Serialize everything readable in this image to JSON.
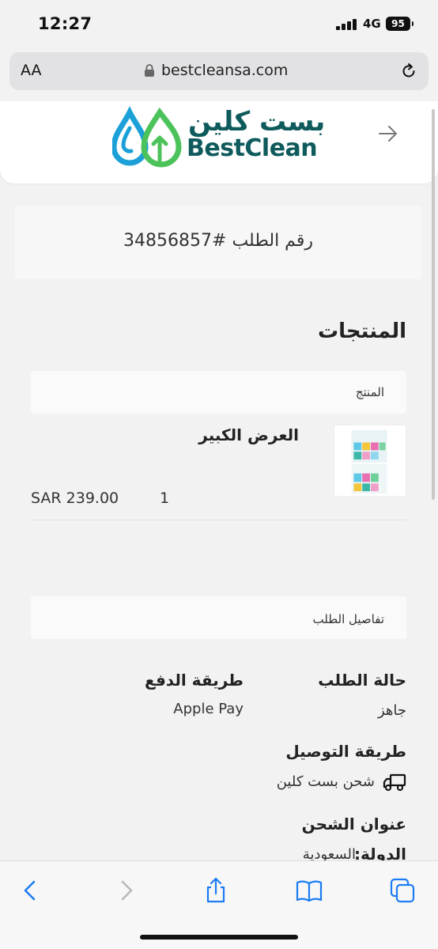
{
  "status_bar": {
    "time": "12:27",
    "network": "4G",
    "battery": "95"
  },
  "browser": {
    "text_size_label": "AA",
    "url": "bestcleansa.com"
  },
  "site": {
    "logo_arabic": "بست كلين",
    "logo_english": "BestClean"
  },
  "order": {
    "number_label": "رقم الطلب #34856857"
  },
  "products": {
    "title": "المنتجات",
    "column_header": "المنتج",
    "items": [
      {
        "name": "العرض الكبير",
        "quantity": "1",
        "price": "SAR 239.00"
      }
    ]
  },
  "details": {
    "header": "تفاصيل الطلب",
    "order_status_label": "حالة الطلب",
    "order_status_value": "جاهز",
    "payment_method_label": "طريقة الدفع",
    "payment_method_value": "Apple Pay",
    "shipping_method_label": "طريقة التوصيل",
    "shipping_method_value": "شحن بست كلين",
    "shipping_address_label": "عنوان الشحن",
    "country_label": "الدولة:",
    "country_value": "السعودية"
  },
  "colors": {
    "brand_teal": "#0f5a5c",
    "brand_blue": "#1ba0d8",
    "brand_green": "#4cc35a",
    "safari_blue": "#1c7cf4"
  }
}
